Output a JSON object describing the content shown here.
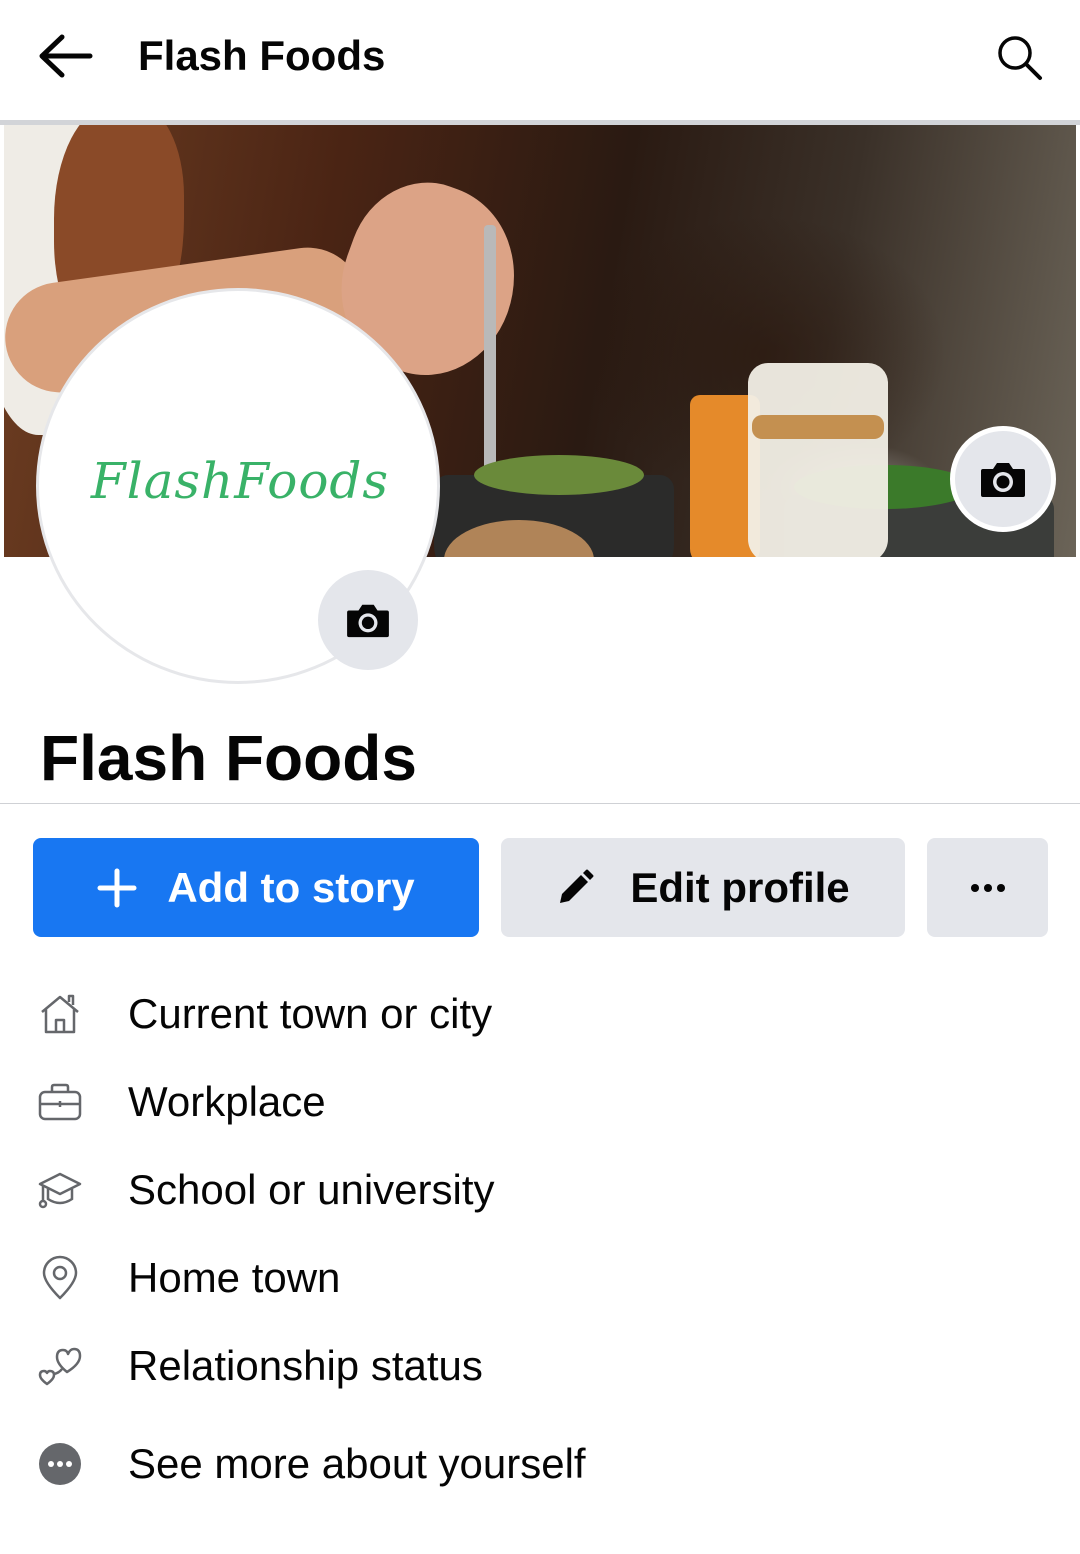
{
  "header": {
    "title": "Flash Foods",
    "back_icon": "back-arrow-icon",
    "search_icon": "search-icon"
  },
  "profile": {
    "name": "Flash Foods",
    "logo_text": "FlashFoods",
    "logo_color": "#39b268"
  },
  "actions": {
    "add_story_label": "Add to story",
    "edit_profile_label": "Edit profile",
    "more_icon": "ellipsis-icon",
    "accent": "#1877f2"
  },
  "details": [
    {
      "label": "Current town or city",
      "icon": "home-icon"
    },
    {
      "label": "Workplace",
      "icon": "briefcase-icon"
    },
    {
      "label": "School or university",
      "icon": "graduation-cap-icon"
    },
    {
      "label": "Home town",
      "icon": "location-pin-icon"
    },
    {
      "label": "Relationship status",
      "icon": "hearts-icon"
    },
    {
      "label": "See more about yourself",
      "icon": "more-dots-icon"
    }
  ]
}
